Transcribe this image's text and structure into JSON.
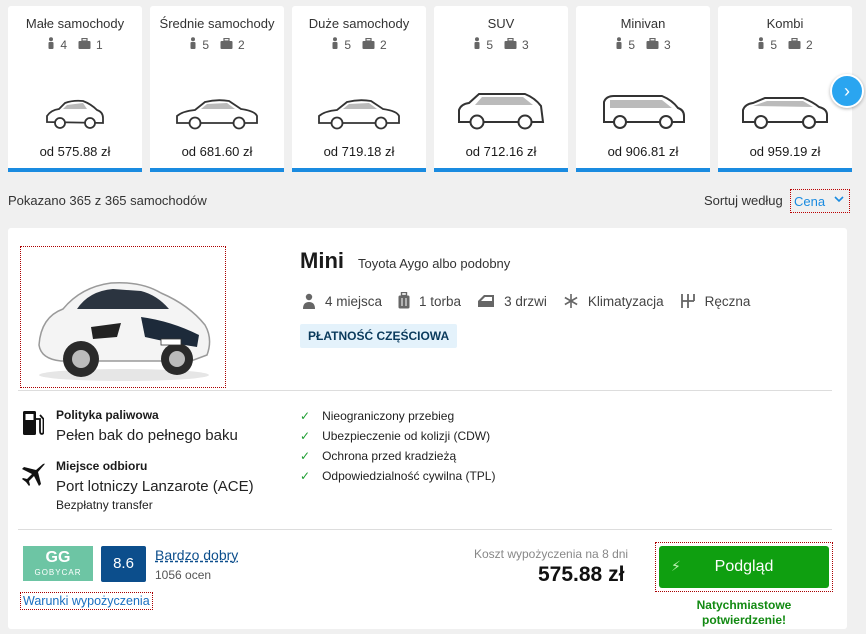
{
  "categories": [
    {
      "name": "Małe samochody",
      "seats": "4",
      "bags": "1",
      "price": "od 575.88 zł",
      "car": "hatch"
    },
    {
      "name": "Średnie samochody",
      "seats": "5",
      "bags": "2",
      "price": "od 681.60 zł",
      "car": "sedan"
    },
    {
      "name": "Duże samochody",
      "seats": "5",
      "bags": "2",
      "price": "od 719.18 zł",
      "car": "sedan"
    },
    {
      "name": "SUV",
      "seats": "5",
      "bags": "3",
      "price": "od 712.16 zł",
      "car": "suv"
    },
    {
      "name": "Minivan",
      "seats": "5",
      "bags": "3",
      "price": "od 906.81 zł",
      "car": "van"
    },
    {
      "name": "Kombi",
      "seats": "5",
      "bags": "2",
      "price": "od 959.19 zł",
      "car": "wagon"
    }
  ],
  "summary": {
    "shown": "Pokazano 365 z 365 samochodów",
    "sort_label": "Sortuj według",
    "sort_value": "Cena"
  },
  "card": {
    "title": "Mini",
    "subtitle": "Toyota Aygo albo podobny",
    "features": {
      "seats": "4 miejsca",
      "bags": "1 torba",
      "doors": "3 drzwi",
      "ac": "Klimatyzacja",
      "gear": "Ręczna"
    },
    "badge": "PŁATNOŚĆ CZĘŚCIOWA",
    "fuel_label": "Polityka paliwowa",
    "fuel_value": "Pełen bak do pełnego baku",
    "pickup_label": "Miejsce odbioru",
    "pickup_value": "Port lotniczy Lanzarote (ACE)",
    "pickup_sub": "Bezpłatny transfer",
    "included": [
      "Nieograniczony przebieg",
      "Ubezpieczenie od kolizji (CDW)",
      "Ochrona przed kradzieżą",
      "Odpowiedzialność cywilna (TPL)"
    ],
    "supplier": {
      "logo_mark": "GG",
      "logo_text": "GOBYCAR"
    },
    "score": "8.6",
    "rating": "Bardzo dobry",
    "reviews": "1056 ocen",
    "terms": "Warunki wypożyczenia",
    "cost_label": "Koszt wypożyczenia na 8 dni",
    "cost_value": "575.88 zł",
    "button": "Podgląd",
    "instant": "Natychmiastowe potwierdzenie!"
  },
  "colors": {
    "accent": "#1a8be0",
    "button": "#0f9f10",
    "score": "#0c4e8c"
  }
}
